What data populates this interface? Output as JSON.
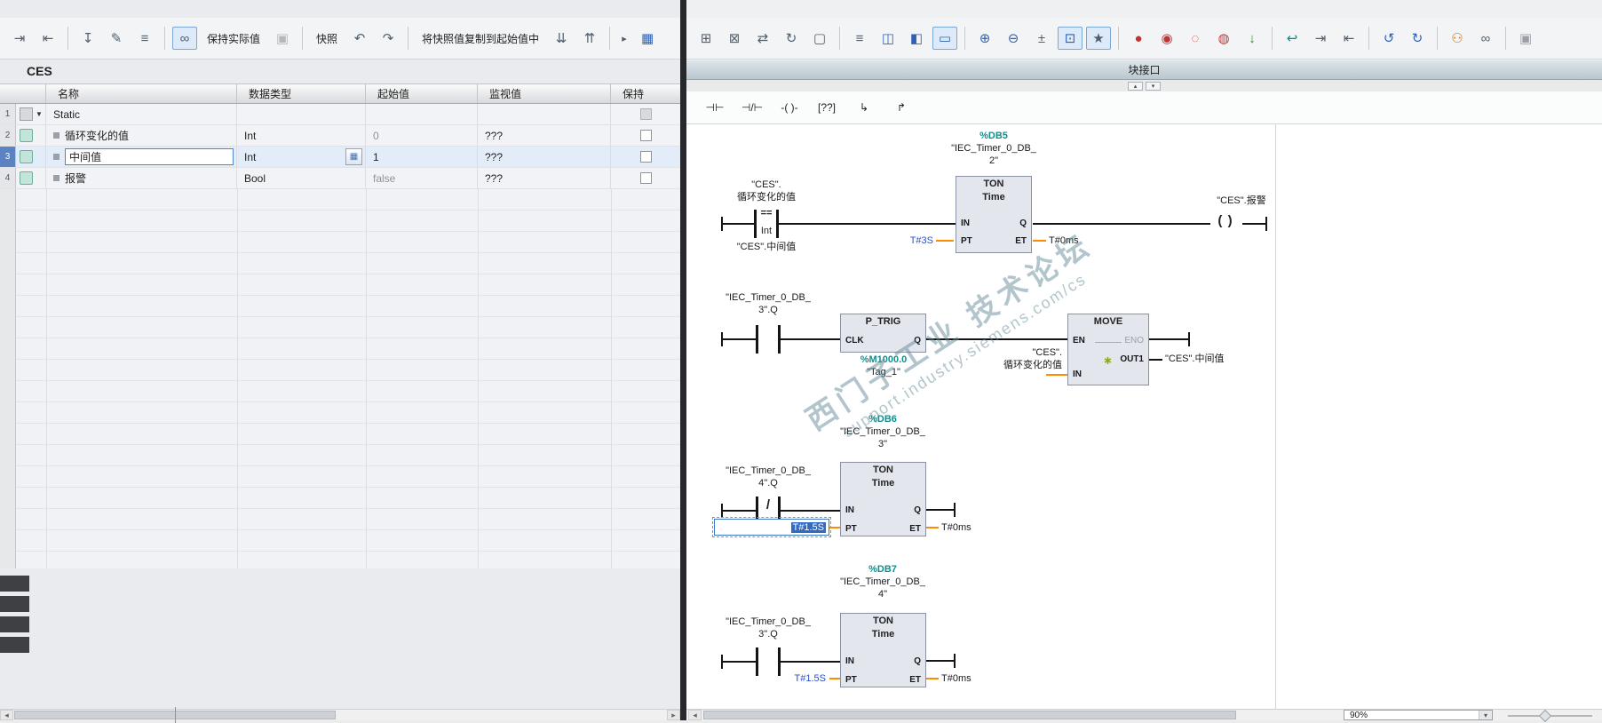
{
  "left_panel": {
    "title": "CES",
    "toolbar": [
      {
        "t": "i",
        "n": "insert-row",
        "g": "⇥"
      },
      {
        "t": "i",
        "n": "add-row",
        "g": "⇤"
      },
      {
        "t": "s"
      },
      {
        "t": "i",
        "n": "load-start-values",
        "g": "↧"
      },
      {
        "t": "i",
        "n": "edit-start-values",
        "g": "✎"
      },
      {
        "t": "i",
        "n": "expanded-mode",
        "g": "≡"
      },
      {
        "t": "s"
      },
      {
        "t": "i",
        "n": "monitor-all",
        "g": "∞",
        "c": "toggled"
      },
      {
        "t": "b",
        "n": "keep-actual-values",
        "label": "保持实际值"
      },
      {
        "t": "i",
        "n": "freeze",
        "g": "▣",
        "c": "disabled"
      },
      {
        "t": "s"
      },
      {
        "t": "b",
        "n": "snapshot",
        "label": "快照"
      },
      {
        "t": "i",
        "n": "copy-snapshot-1",
        "g": "↶"
      },
      {
        "t": "i",
        "n": "copy-snapshot-2",
        "g": "↷"
      },
      {
        "t": "s"
      },
      {
        "t": "b",
        "n": "copy-snapshot-to-start",
        "label": "将快照值复制到起始值中"
      },
      {
        "t": "i",
        "n": "copy-start-1",
        "g": "⇊"
      },
      {
        "t": "i",
        "n": "copy-start-2",
        "g": "⇈"
      },
      {
        "t": "s"
      },
      {
        "t": "i",
        "n": "more",
        "g": "▸",
        "c": "small"
      },
      {
        "t": "i",
        "n": "watch-table",
        "g": "▦",
        "c": "blue"
      }
    ],
    "table": {
      "headers": [
        "名称",
        "数据类型",
        "起始值",
        "监视值",
        "保持"
      ],
      "rows": [
        {
          "num": "1",
          "name": "Static",
          "type": "",
          "start": "",
          "monitor": ""
        },
        {
          "num": "2",
          "name": "循环变化的值",
          "type": "Int",
          "start": "0",
          "monitor": "???"
        },
        {
          "num": "3",
          "name": "中间值",
          "type": "Int",
          "start": "1",
          "monitor": "???"
        },
        {
          "num": "4",
          "name": "报警",
          "type": "Bool",
          "start": "false",
          "monitor": "???"
        }
      ]
    }
  },
  "right_panel": {
    "block_interface_label": "块接口",
    "zoom": "90%",
    "toolbar": [
      {
        "t": "i",
        "n": "insert-network",
        "g": "⊞"
      },
      {
        "t": "i",
        "n": "delete-network",
        "g": "⊠"
      },
      {
        "t": "i",
        "n": "rewire",
        "g": "⇄"
      },
      {
        "t": "i",
        "n": "update-block-call",
        "g": "↻"
      },
      {
        "t": "i",
        "n": "insert-box",
        "g": "▢"
      },
      {
        "t": "s"
      },
      {
        "t": "i",
        "n": "absolute-operands",
        "g": "≡"
      },
      {
        "t": "i",
        "n": "split-horizontal",
        "g": "◫",
        "c": "blue"
      },
      {
        "t": "i",
        "n": "split-vertical",
        "g": "◧",
        "c": "blue"
      },
      {
        "t": "i",
        "n": "network-comments",
        "g": "▭",
        "c": "toggled blue"
      },
      {
        "t": "s"
      },
      {
        "t": "i",
        "n": "expand-networks",
        "g": "⊕",
        "c": "blue"
      },
      {
        "t": "i",
        "n": "collapse-networks",
        "g": "⊖",
        "c": "blue"
      },
      {
        "t": "i",
        "n": "symbol-information",
        "g": "±"
      },
      {
        "t": "i",
        "n": "status-display",
        "g": "⊡",
        "c": "toggled blue"
      },
      {
        "t": "i",
        "n": "favorites-toggle",
        "g": "★",
        "c": "toggled"
      },
      {
        "t": "s"
      },
      {
        "t": "i",
        "n": "breakpoint-set",
        "g": "●",
        "c": "red"
      },
      {
        "t": "i",
        "n": "breakpoint-next",
        "g": "◉",
        "c": "red"
      },
      {
        "t": "i",
        "n": "breakpoint-delete",
        "g": "◌",
        "c": "red"
      },
      {
        "t": "i",
        "n": "breakpoint-enable",
        "g": "◍",
        "c": "red"
      },
      {
        "t": "i",
        "n": "download",
        "g": "↓",
        "c": "green"
      },
      {
        "t": "s"
      },
      {
        "t": "i",
        "n": "jump-back",
        "g": "↩",
        "c": "teal"
      },
      {
        "t": "i",
        "n": "indent",
        "g": "⇥"
      },
      {
        "t": "i",
        "n": "outdent",
        "g": "⇤"
      },
      {
        "t": "s"
      },
      {
        "t": "i",
        "n": "go-online",
        "g": "↺",
        "c": "blue"
      },
      {
        "t": "i",
        "n": "go-offline",
        "g": "↻",
        "c": "blue"
      },
      {
        "t": "s"
      },
      {
        "t": "i",
        "n": "user-filter",
        "g": "⚇",
        "c": "orange"
      },
      {
        "t": "i",
        "n": "monitor-glasses",
        "g": "∞"
      },
      {
        "t": "s"
      },
      {
        "t": "i",
        "n": "know-how-protection",
        "g": "▣",
        "c": "dim"
      }
    ],
    "favorites": [
      {
        "t": "i",
        "n": "no-contact",
        "g": "⊣⊢"
      },
      {
        "t": "i",
        "n": "nc-contact",
        "g": "⊣/⊢"
      },
      {
        "t": "i",
        "n": "coil",
        "g": "-( )-"
      },
      {
        "t": "i",
        "n": "empty-box",
        "g": "[??]"
      },
      {
        "t": "i",
        "n": "open-branch",
        "g": "↳"
      },
      {
        "t": "i",
        "n": "close-branch",
        "g": "↱"
      }
    ],
    "watermark": {
      "line1": "西门子工业 技术论坛",
      "line2": "support.industry.siemens.com/cs"
    }
  },
  "ladder": {
    "net1": {
      "db_addr": "%DB5",
      "db_name1": "\"IEC_Timer_0_DB_",
      "db_name2": "2\"",
      "cmp_op1_l1": "\"CES\".",
      "cmp_op1_l2": "循环变化的值",
      "cmp_symbol": "==",
      "cmp_type": "Int",
      "cmp_op2": "\"CES\".中间值",
      "box_title": "TON",
      "box_sub": "Time",
      "pin_in": "IN",
      "pin_q": "Q",
      "pin_pt": "PT",
      "pin_et": "ET",
      "pt_value": "T#3S",
      "et_value": "T#0ms",
      "coil_operand": "\"CES\".报警"
    },
    "net2": {
      "contact_op_l1": "\"IEC_Timer_0_DB_",
      "contact_op_l2": "3\".Q",
      "ptrig_title": "P_TRIG",
      "pin_clk": "CLK",
      "pin_q": "Q",
      "mem_addr": "%M1000.0",
      "mem_name": "\"Tag_1\"",
      "move_title": "MOVE",
      "pin_en": "EN",
      "pin_eno": "ENO",
      "pin_out1": "OUT1",
      "pin_in": "IN",
      "in_op_l1": "\"CES\".",
      "in_op_l2": "循环变化的值",
      "out_op": "\"CES\".中间值"
    },
    "net3": {
      "db_addr": "%DB6",
      "db_name1": "\"IEC_Timer_0_DB_",
      "db_name2": "3\"",
      "contact_op_l1": "\"IEC_Timer_0_DB_",
      "contact_op_l2": "4\".Q",
      "box_title": "TON",
      "box_sub": "Time",
      "pin_in": "IN",
      "pin_q": "Q",
      "pin_pt": "PT",
      "pin_et": "ET",
      "pt_value": "T#1.5S",
      "et_value": "T#0ms"
    },
    "net4": {
      "db_addr": "%DB7",
      "db_name1": "\"IEC_Timer_0_DB_",
      "db_name2": "4\"",
      "contact_op_l1": "\"IEC_Timer_0_DB_",
      "contact_op_l2": "3\".Q",
      "box_title": "TON",
      "box_sub": "Time",
      "pin_in": "IN",
      "pin_q": "Q",
      "pin_pt": "PT",
      "pin_et": "ET",
      "pt_value": "T#1.5S",
      "et_value": "T#0ms"
    }
  },
  "icons": {
    "coil": "( )",
    "nc_slash": "/",
    "collapse_up": "▴",
    "collapse_down": "▾",
    "scroll_left": "◂",
    "scroll_right": "▸",
    "zoom_caret": "▾",
    "out_star": "∗",
    "row_expander": "▼"
  }
}
